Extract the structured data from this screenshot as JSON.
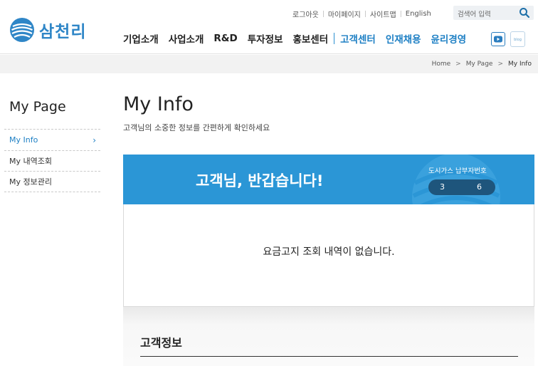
{
  "brand": {
    "name": "삼천리",
    "color": "#2f86c7"
  },
  "util_links": [
    "로그아웃",
    "마이페이지",
    "사이트맵",
    "English"
  ],
  "search": {
    "placeholder": "검색어 입력",
    "icon": "search-icon"
  },
  "gnb": {
    "items": [
      "기업소개",
      "사업소개",
      "R&D",
      "투자정보",
      "홍보센터"
    ],
    "blue_items": [
      "고객센터",
      "인재채용",
      "윤리경영"
    ],
    "accent": "#1d7fc4"
  },
  "sns": {
    "youtube_icon": "youtube-icon",
    "blog_icon": "blog-icon"
  },
  "breadcrumb": [
    "Home",
    "My Page",
    "My Info"
  ],
  "side": {
    "title": "My Page",
    "items": [
      {
        "label": "My Info",
        "active": true
      },
      {
        "label": "My 내역조회",
        "active": false
      },
      {
        "label": "My 정보관리",
        "active": false
      }
    ]
  },
  "main": {
    "title": "My Info",
    "subtitle": "고객님의 소중한 정보를 간편하게 확인하세요",
    "banner": {
      "greeting": "고객님, 반갑습니다!",
      "customer_label": "도시가스 납부자번호",
      "customer_no_left": "3",
      "customer_no_right": "6",
      "color": "#2b96d6"
    },
    "notice": "요금고지 조회 내역이 없습니다.",
    "info_title": "고객정보"
  }
}
